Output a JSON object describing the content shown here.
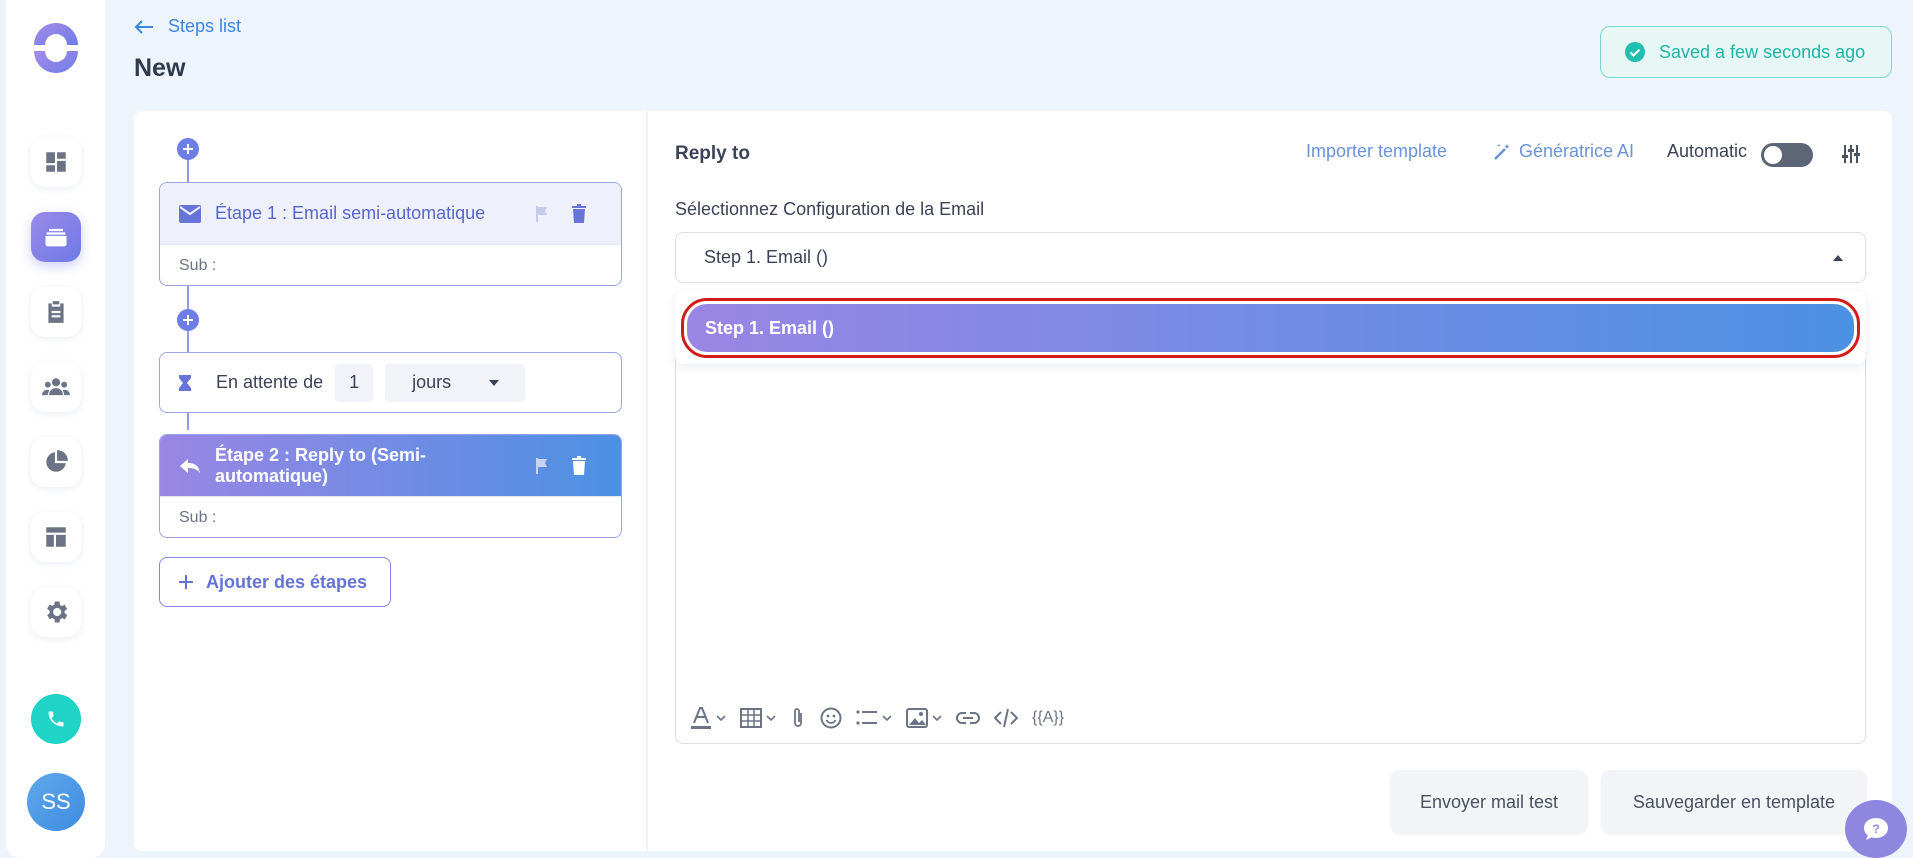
{
  "header": {
    "back_label": "Steps list",
    "page_title": "New",
    "saved_text": "Saved a few seconds ago"
  },
  "sidebar": {
    "avatar_initials": "SS",
    "items": [
      {
        "icon": "dashboard-icon"
      },
      {
        "icon": "inbox-icon",
        "active": true
      },
      {
        "icon": "clipboard-icon"
      },
      {
        "icon": "users-icon"
      },
      {
        "icon": "pie-chart-icon"
      },
      {
        "icon": "layout-icon"
      },
      {
        "icon": "gear-icon"
      }
    ]
  },
  "steps": {
    "step1": {
      "title": "Étape 1 : Email semi-automatique",
      "sub": "Sub :"
    },
    "wait": {
      "label": "En attente de",
      "value": "1",
      "unit": "jours"
    },
    "step2": {
      "title": "Étape 2 : Reply to (Semi-automatique)",
      "sub": "Sub :"
    },
    "add_label": "Ajouter des étapes"
  },
  "editor": {
    "title": "Reply to",
    "import_label": "Importer template",
    "ai_label": "Génératrice AI",
    "automatic_label": "Automatic",
    "automatic_on": false,
    "select_label": "Sélectionnez Configuration de la Email",
    "select_value": "Step 1. Email ()",
    "dropdown_options": [
      "Step 1. Email ()"
    ],
    "variable_label": "{{A}}",
    "send_test_label": "Envoyer mail test",
    "save_template_label": "Sauvegarder en template"
  },
  "colors": {
    "accent": "#6f7de6",
    "success": "#20b5a6",
    "phone": "#1fd3c6",
    "highlight_border": "#d41b1b"
  }
}
